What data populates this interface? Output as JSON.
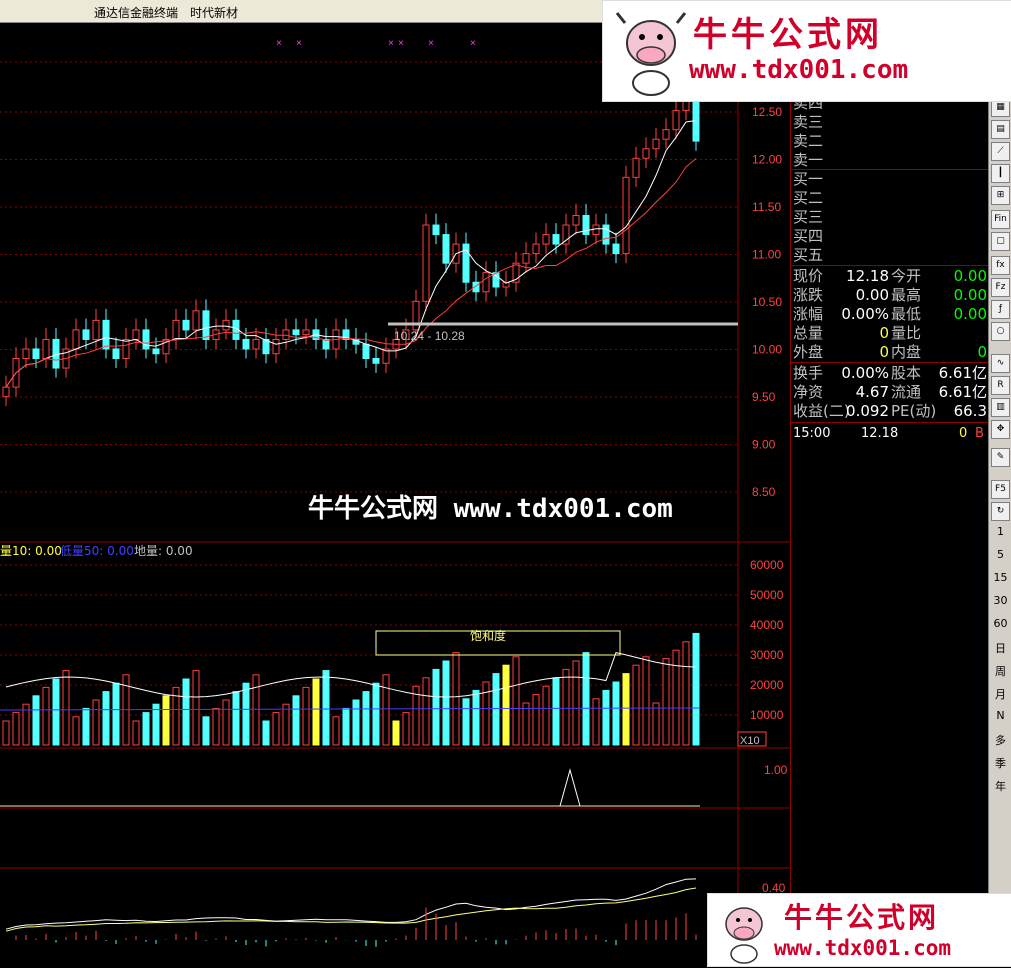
{
  "titlebar": {
    "app_name": "通达信金融终端",
    "stock_name": "时代新材"
  },
  "price_axis": [
    "12.50",
    "12.00",
    "11.50",
    "11.00",
    "10.50",
    "10.00",
    "9.50",
    "9.00",
    "8.50"
  ],
  "range_label": "10.24 - 10.28",
  "volume_header": {
    "vol10": "量10: 0.00",
    "vol50": "低量50: 0.00",
    "ground": "地量: 0.00"
  },
  "volume_axis": [
    "60000",
    "50000",
    "40000",
    "30000",
    "20000",
    "10000"
  ],
  "volume_unit": "X10",
  "saturation_label": "饱和度",
  "signal_axis": [
    "1.00"
  ],
  "osc_axis": [
    "0.40"
  ],
  "quote": {
    "sell": [
      "卖四",
      "卖三",
      "卖二",
      "卖一"
    ],
    "buy": [
      "买一",
      "买二",
      "买三",
      "买四",
      "买五"
    ],
    "stats": [
      {
        "l1": "现价",
        "v1": "12.18",
        "l2": "今开",
        "v2": "0.00"
      },
      {
        "l1": "涨跌",
        "v1": "0.00",
        "l2": "最高",
        "v2": "0.00"
      },
      {
        "l1": "涨幅",
        "v1": "0.00%",
        "l2": "最低",
        "v2": "0.00"
      },
      {
        "l1": "总量",
        "v1": "0",
        "l2": "量比",
        "v2": ""
      },
      {
        "l1": "外盘",
        "v1": "0",
        "l2": "内盘",
        "v2": "0"
      }
    ],
    "stats2": [
      {
        "l1": "换手",
        "v1": "0.00%",
        "l2": "股本",
        "v2": "6.61亿"
      },
      {
        "l1": "净资",
        "v1": "4.67",
        "l2": "流通",
        "v2": "6.61亿"
      },
      {
        "l1": "收益(二)",
        "v1": "0.092",
        "l2": "PE(动)",
        "v2": "66.3"
      }
    ],
    "tick": {
      "time": "15:00",
      "price": "12.18",
      "vol": "0",
      "flag": "B"
    }
  },
  "toolbar": {
    "periods": [
      "1",
      "5",
      "15",
      "30",
      "60",
      "日",
      "周",
      "月",
      "N",
      "多",
      "季",
      "年"
    ],
    "icons": [
      "F5"
    ]
  },
  "watermark": {
    "brand": "牛牛公式网",
    "url": "www.tdx001.com",
    "center": "牛牛公式网 www.tdx001.com"
  },
  "chart_data": {
    "type": "candlestick",
    "close": [
      9.6,
      9.9,
      10.0,
      9.9,
      10.1,
      9.8,
      10.0,
      10.2,
      10.1,
      10.3,
      10.0,
      9.9,
      10.1,
      10.2,
      10.0,
      9.95,
      10.1,
      10.3,
      10.2,
      10.4,
      10.1,
      10.2,
      10.3,
      10.1,
      10.0,
      10.1,
      9.95,
      10.1,
      10.2,
      10.15,
      10.2,
      10.1,
      10.0,
      10.2,
      10.1,
      10.05,
      9.9,
      9.85,
      10.0,
      10.1,
      10.2,
      10.5,
      11.3,
      11.2,
      10.9,
      11.1,
      10.7,
      10.6,
      10.8,
      10.65,
      10.7,
      10.9,
      11.0,
      11.1,
      11.2,
      11.1,
      11.3,
      11.4,
      11.2,
      11.3,
      11.1,
      11.0,
      11.8,
      12.0,
      12.1,
      12.2,
      12.3,
      12.5,
      12.8,
      12.18
    ],
    "ylim": [
      8.5,
      12.8
    ],
    "volume_max": 60000
  },
  "colors": {
    "up": "#ff4040",
    "down": "#54ffff",
    "grid": "#8b0000",
    "ma_white": "#ffffff",
    "ma_red": "#ff4040",
    "yellow": "#ffff40"
  }
}
